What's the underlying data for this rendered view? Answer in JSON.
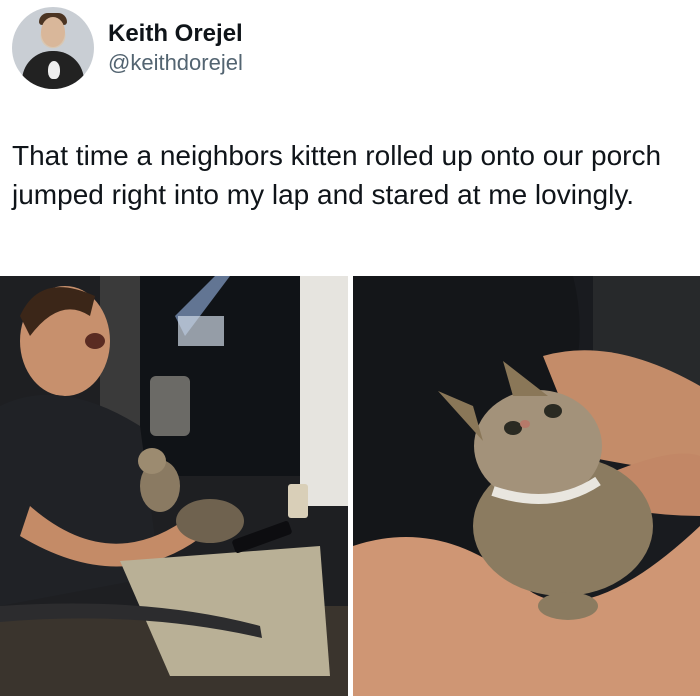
{
  "author": {
    "display_name": "Keith Orejel",
    "handle": "@keithdorejel"
  },
  "tweet": {
    "text": "That time a neighbors kitten rolled up onto our porch jumped right into my lap and stared at me lovingly."
  },
  "media": {
    "count": 2,
    "icons": [
      "avatar-photo",
      "photo-man-with-kitten",
      "photo-kitten-closeup"
    ]
  },
  "colors": {
    "text": "#0f1419",
    "secondary": "#536471",
    "background": "#ffffff"
  }
}
